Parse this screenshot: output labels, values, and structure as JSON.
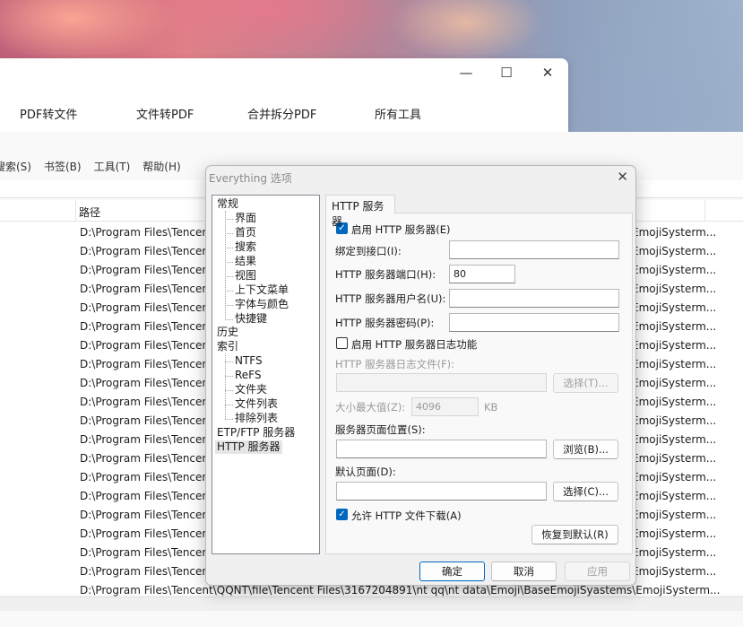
{
  "pdf_window": {
    "tabs": [
      "PDF转文件",
      "文件转PDF",
      "合并拆分PDF",
      "所有工具"
    ],
    "controls": {
      "minimize": "—",
      "maximize": "☐",
      "close": "✕"
    }
  },
  "everything": {
    "menu": [
      "搜索(S)",
      "书签(B)",
      "工具(T)",
      "帮助(H)"
    ],
    "column_path": "路径",
    "row_path_prefix": "D:\\Program Files\\Tencent",
    "row_path_suffix": "EmojiSysterm...",
    "last_row_path": "D:\\Program Files\\Tencent\\QQNT\\file\\Tencent Files\\3167204891\\nt qq\\nt data\\Emoji\\BaseEmojiSyastems\\EmojiSysterm...",
    "row_count": 20
  },
  "dialog": {
    "title": "Everything 选项",
    "close": "✕",
    "tree": {
      "general": "常规",
      "general_children": [
        "界面",
        "首页",
        "搜索",
        "结果",
        "视图",
        "上下文菜单",
        "字体与颜色",
        "快捷键"
      ],
      "history": "历史",
      "index": "索引",
      "index_children": [
        "NTFS",
        "ReFS",
        "文件夹",
        "文件列表",
        "排除列表"
      ],
      "etp": "ETP/FTP 服务器",
      "http": "HTTP 服务器"
    },
    "tab_label": "HTTP 服务器",
    "enable_http": "启用 HTTP 服务器(E)",
    "bind_interface": "绑定到接口(I):",
    "bind_interface_value": "",
    "port_label": "HTTP 服务器端口(H):",
    "port_value": "80",
    "username_label": "HTTP 服务器用户名(U):",
    "password_label": "HTTP 服务器密码(P):",
    "enable_log": "启用 HTTP 服务器日志功能",
    "log_file_label": "HTTP 服务器日志文件(F):",
    "log_select": "选择(T)...",
    "max_size_label": "大小最大值(Z):",
    "max_size_value": "4096",
    "max_size_unit": "KB",
    "page_location_label": "服务器页面位置(S):",
    "browse": "浏览(B)...",
    "default_page_label": "默认页面(D):",
    "default_select": "选择(C)...",
    "allow_download": "允许 HTTP 文件下载(A)",
    "restore_default": "恢复到默认(R)",
    "ok": "确定",
    "cancel": "取消",
    "apply": "应用",
    "checkbox_enable_http_checked": true,
    "checkbox_log_checked": false,
    "checkbox_download_checked": true
  }
}
